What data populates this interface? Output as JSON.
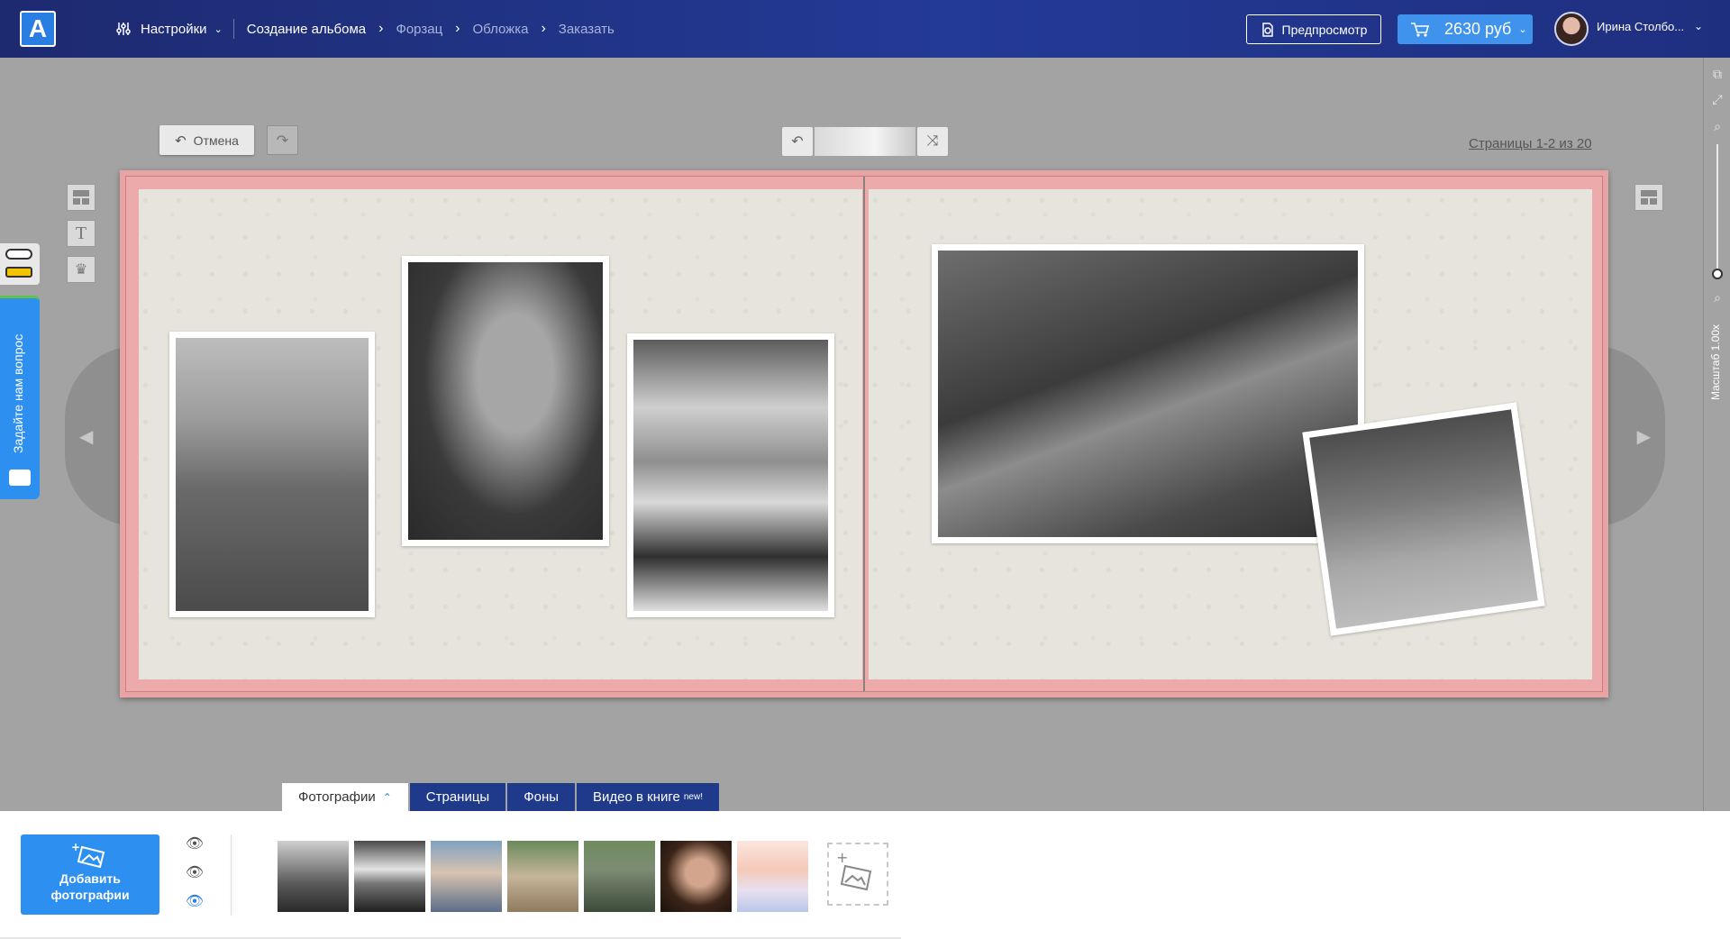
{
  "header": {
    "logo_letter": "A",
    "breadcrumb": [
      {
        "label": "Настройки",
        "state": "active"
      },
      {
        "label": "Создание альбома",
        "state": "current"
      },
      {
        "label": "Форзац",
        "state": "dim"
      },
      {
        "label": "Обложка",
        "state": "dim"
      },
      {
        "label": "Заказать",
        "state": "dim"
      }
    ],
    "preview_label": "Предпросмотр",
    "cart_price": "2630 руб",
    "user_name": "Ирина Столбо..."
  },
  "toolbar": {
    "undo_label": "Отмена",
    "pages_indicator": "Страницы 1-2 из 20"
  },
  "zoom": {
    "label": "Масштаб 1.00x"
  },
  "feedback": {
    "label": "Задайте нам вопрос"
  },
  "bottom_tabs": [
    {
      "label": "Фотографии",
      "active": true
    },
    {
      "label": "Страницы",
      "active": false
    },
    {
      "label": "Фоны",
      "active": false
    },
    {
      "label": "Видео в книге",
      "badge": "new!",
      "active": false
    }
  ],
  "panel": {
    "add_photos_line1": "Добавить",
    "add_photos_line2": "фотографии"
  },
  "colors": {
    "header_bg": "#233a96",
    "accent_blue": "#2d8ff0",
    "album_border": "#e8a4a4",
    "tab_bg": "#1f3a8a"
  },
  "icons": [
    "settings-sliders-icon",
    "preview-icon",
    "cart-icon",
    "undo-icon",
    "redo-icon",
    "shuffle-icon",
    "layout-icon",
    "text-icon",
    "crown-icon",
    "eye-icon",
    "add-photo-icon",
    "chat-icon",
    "zoom-in-icon",
    "zoom-out-icon",
    "fullscreen-icon",
    "external-icon"
  ]
}
